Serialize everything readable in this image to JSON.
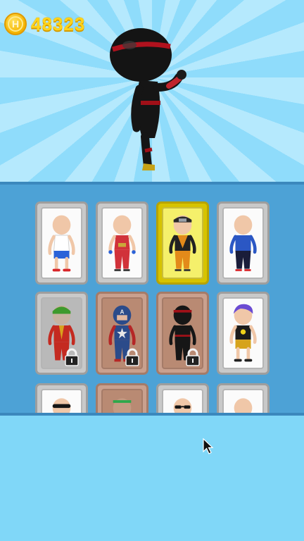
{
  "currency": {
    "icon": "coin-icon",
    "symbol": "H",
    "amount": "48323"
  },
  "hero": {
    "icon": "ninja-character-preview"
  },
  "skins": [
    {
      "id": "tank-top",
      "icon": "tank-top-character-icon",
      "state": "unlocked"
    },
    {
      "id": "red-vest",
      "icon": "red-vest-character-icon",
      "state": "unlocked"
    },
    {
      "id": "orange-ninja",
      "icon": "orange-ninja-character-icon",
      "state": "selected"
    },
    {
      "id": "blue-shirt",
      "icon": "blue-shirt-character-icon",
      "state": "unlocked"
    },
    {
      "id": "joker",
      "icon": "joker-character-icon",
      "state": "locked"
    },
    {
      "id": "captain",
      "icon": "captain-character-icon",
      "state": "locked"
    },
    {
      "id": "black-ninja",
      "icon": "black-ninja-character-icon",
      "state": "locked"
    },
    {
      "id": "purple-hair",
      "icon": "purple-hair-character-icon",
      "state": "unlocked"
    },
    {
      "id": "masked",
      "icon": "masked-character-icon",
      "state": "unlocked"
    },
    {
      "id": "green-band",
      "icon": "green-band-character-icon",
      "state": "locked"
    },
    {
      "id": "sunglasses",
      "icon": "sunglasses-character-icon",
      "state": "unlocked"
    },
    {
      "id": "plain",
      "icon": "plain-character-icon",
      "state": "unlocked"
    }
  ],
  "colors": {
    "sky": "#8fdcfb",
    "panel": "#4da2d6",
    "selected": "#f5f06b",
    "coin": "#ffd41a"
  }
}
